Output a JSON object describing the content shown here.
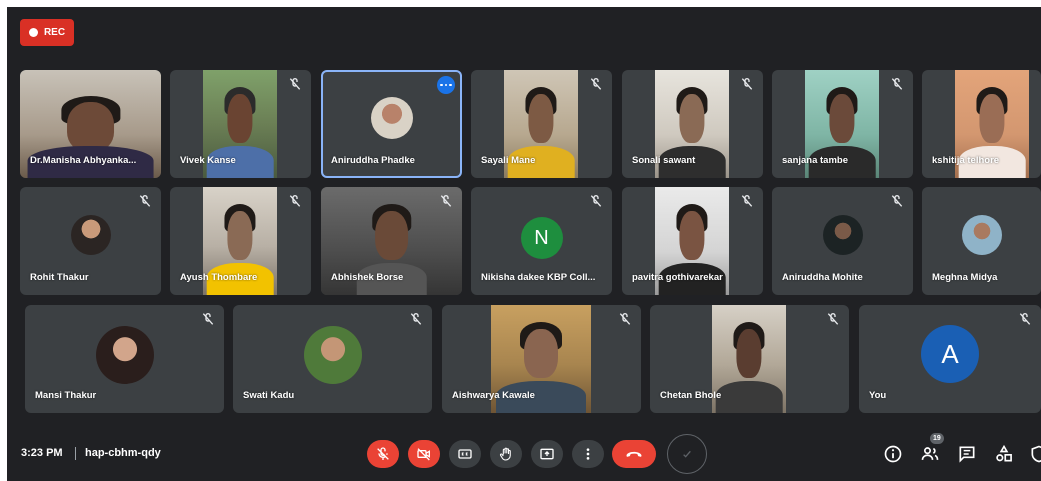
{
  "recording": {
    "label": "REC"
  },
  "participants": {
    "row1": [
      {
        "name": "Dr.Manisha Abhyanka..."
      },
      {
        "name": "Vivek Kanse"
      },
      {
        "name": "Aniruddha Phadke"
      },
      {
        "name": "Sayali Mane"
      },
      {
        "name": "Sonali sawant"
      },
      {
        "name": "sanjana tambe"
      },
      {
        "name": "kshitija telhore"
      }
    ],
    "row2": [
      {
        "name": "Rohit Thakur"
      },
      {
        "name": "Ayush Thombare"
      },
      {
        "name": "Abhishek Borse"
      },
      {
        "name": "Nikisha dakee KBP Coll...",
        "initial": "N"
      },
      {
        "name": "pavitra gothivarekar"
      },
      {
        "name": "Aniruddha Mohite"
      },
      {
        "name": "Meghna Midya"
      }
    ],
    "row3": [
      {
        "name": "Mansi Thakur"
      },
      {
        "name": "Swati Kadu"
      },
      {
        "name": "Aishwarya Kawale"
      },
      {
        "name": "Chetan Bhole"
      },
      {
        "name": "You",
        "initial": "A"
      }
    ]
  },
  "meeting": {
    "time": "3:23 PM",
    "code": "hap-cbhm-qdy",
    "participant_count": "19"
  },
  "colors": {
    "background": "#202124",
    "tile": "#3c4043",
    "danger": "#ea4335",
    "active_border": "#8ab4f8",
    "avatar_green": "#1e8e3e",
    "avatar_blue": "#1a5fb4"
  }
}
